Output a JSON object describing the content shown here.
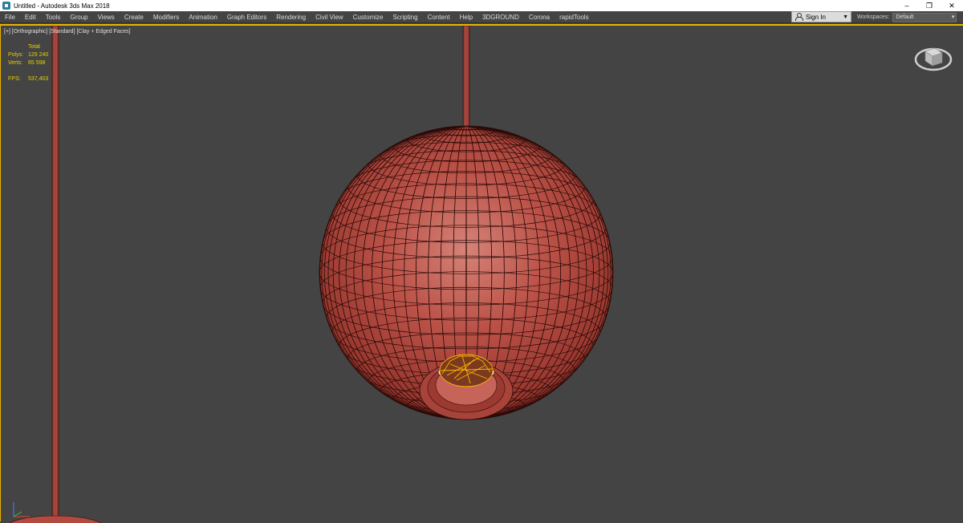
{
  "window": {
    "title": "Untitled - Autodesk 3ds Max 2018",
    "controls": {
      "minimize": "–",
      "restore": "❐",
      "close": "✕"
    }
  },
  "menu": {
    "items": [
      "File",
      "Edit",
      "Tools",
      "Group",
      "Views",
      "Create",
      "Modifiers",
      "Animation",
      "Graph Editors",
      "Rendering",
      "Civil View",
      "Customize",
      "Scripting",
      "Content",
      "Help",
      "3DGROUND",
      "Corona",
      "rapidTools"
    ],
    "signin_label": "Sign In",
    "workspaces_label": "Workspaces:",
    "workspaces_value": "Default"
  },
  "viewport": {
    "label": "[+] [Orthographic] [Standard] [Clay + Edged Faces]",
    "stats": {
      "total_label": "Total",
      "polys_label": "Polys:",
      "polys_value": "129 240",
      "verts_label": "Verts:",
      "verts_value": "65 598",
      "fps_label": "FPS:",
      "fps_value": "537,403"
    },
    "colors": {
      "background": "#444444",
      "active_border": "#e8b400",
      "clay_red": "#b5473f",
      "stats_text": "#e7d200",
      "selection": "#ffb400"
    }
  }
}
